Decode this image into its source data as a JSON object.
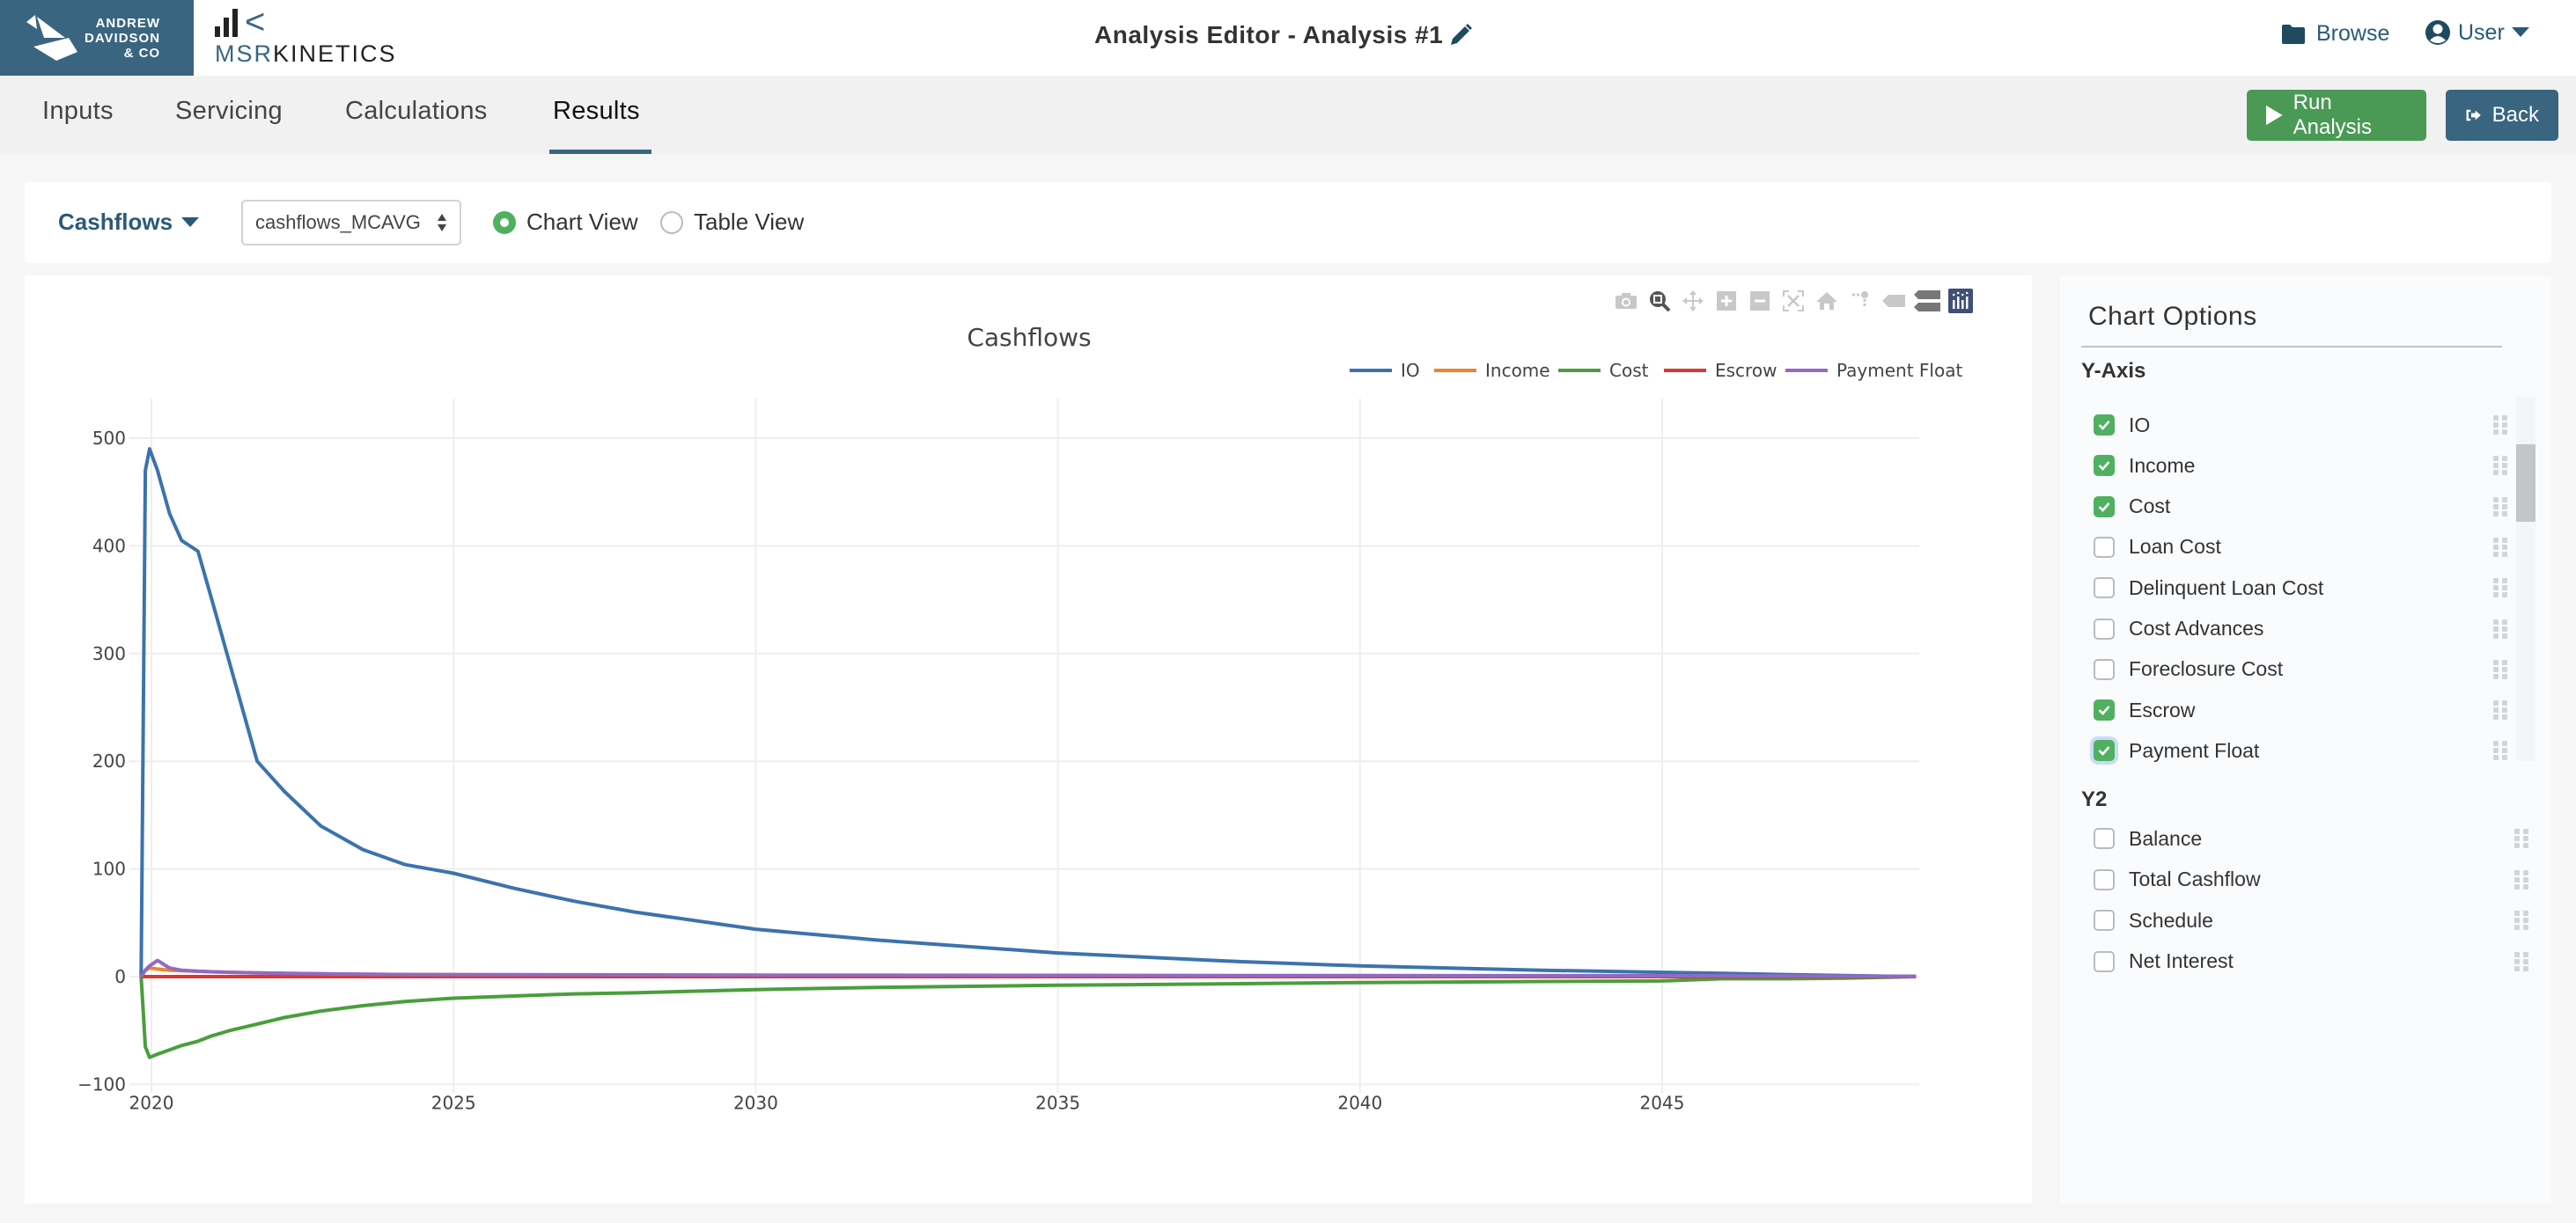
{
  "header": {
    "brand_left": [
      "ANDREW",
      "DAVIDSON",
      "& CO"
    ],
    "brand_right_a": "MSR",
    "brand_right_b": "KINETICS",
    "title": "Analysis Editor - Analysis #1",
    "edit_icon": "pencil-icon",
    "browse_label": "Browse",
    "browse_icon": "folder-icon",
    "user_label": "User",
    "user_icon": "user-circle-icon"
  },
  "tabs": [
    {
      "label": "Inputs",
      "active": false
    },
    {
      "label": "Servicing",
      "active": false
    },
    {
      "label": "Calculations",
      "active": false
    },
    {
      "label": "Results",
      "active": true
    }
  ],
  "actions": {
    "run_label": "Run Analysis",
    "run_icon": "play-icon",
    "back_label": "Back",
    "back_icon": "sign-out-icon"
  },
  "filters": {
    "report_label": "Cashflows",
    "dataset_value": "cashflows_MCAVG",
    "view_options": [
      {
        "label": "Chart View",
        "selected": true
      },
      {
        "label": "Table View",
        "selected": false
      }
    ]
  },
  "modebar": [
    "camera-icon",
    "zoom-icon",
    "pan-icon",
    "zoom-in-icon",
    "zoom-out-icon",
    "autoscale-icon",
    "reset-axes-icon",
    "spike-lines-icon",
    "hover-closest-icon",
    "hover-compare-icon",
    "plotly-logo-icon"
  ],
  "chart_data": {
    "type": "line",
    "title": "Cashflows",
    "xlabel": "",
    "ylabel": "",
    "xlim": [
      2019.8,
      2049.2
    ],
    "ylim": [
      -100,
      520
    ],
    "xticks": [
      2020,
      2025,
      2030,
      2035,
      2040,
      2045
    ],
    "yticks": [
      -100,
      0,
      100,
      200,
      300,
      400,
      500
    ],
    "ytick_labels": [
      "−100",
      "0",
      "100",
      "200",
      "300",
      "400",
      "500"
    ],
    "grid": true,
    "legend_position": "top-right",
    "x": [
      2019.83,
      2019.9,
      2019.97,
      2020.1,
      2020.3,
      2020.5,
      2020.77,
      2021.0,
      2021.3,
      2021.75,
      2022.2,
      2022.8,
      2023.5,
      2024.2,
      2025,
      2026,
      2027,
      2028,
      2030,
      2032,
      2035,
      2038,
      2040,
      2043,
      2045,
      2046,
      2047,
      2048,
      2049.2
    ],
    "series": [
      {
        "name": "IO",
        "color": "#3b73ad",
        "values": [
          0,
          470,
          490,
          470,
          430,
          405,
          395,
          350,
          290,
          200,
          172,
          140,
          118,
          104,
          96,
          82,
          70,
          60,
          44,
          34,
          22,
          14,
          10,
          6,
          4,
          3,
          2,
          1,
          0
        ]
      },
      {
        "name": "Income",
        "color": "#f0842d",
        "values": [
          0,
          6,
          8,
          7,
          6,
          5.5,
          5,
          4.5,
          4,
          3.5,
          3,
          2.6,
          2.2,
          2,
          1.8,
          1.6,
          1.5,
          1.4,
          1.2,
          1.1,
          1,
          0.8,
          0.7,
          0.5,
          0.4,
          0.3,
          0.2,
          0.1,
          0
        ]
      },
      {
        "name": "Cost",
        "color": "#4a9e3d",
        "values": [
          0,
          -65,
          -75,
          -72,
          -68,
          -64,
          -60,
          -55,
          -50,
          -44,
          -38,
          -32,
          -27,
          -23,
          -20,
          -18,
          -16,
          -15,
          -12,
          -10,
          -8,
          -6.5,
          -5.5,
          -4.5,
          -4,
          -2,
          -2,
          -1.5,
          0
        ]
      },
      {
        "name": "Escrow",
        "color": "#d33b33",
        "values": [
          0,
          0,
          0,
          0,
          0,
          0,
          0,
          0,
          0,
          0,
          0,
          0,
          0,
          0,
          0,
          0,
          0,
          0,
          0,
          0,
          0,
          0,
          0,
          0,
          0,
          0,
          0,
          0,
          0
        ]
      },
      {
        "name": "Payment Float",
        "color": "#9369c4",
        "values": [
          0,
          6,
          10,
          15,
          8,
          6,
          5,
          4.5,
          4,
          3.5,
          3,
          2.6,
          2.2,
          2,
          1.9,
          1.8,
          1.7,
          1.6,
          1.4,
          1.3,
          1.2,
          1.1,
          1,
          0.9,
          0.8,
          0.7,
          0.6,
          0.5,
          0.4
        ]
      }
    ]
  },
  "options": {
    "title": "Chart Options",
    "y_axis_label": "Y-Axis",
    "y_axis_items": [
      {
        "label": "IO",
        "checked": true
      },
      {
        "label": "Income",
        "checked": true
      },
      {
        "label": "Cost",
        "checked": true
      },
      {
        "label": "Loan Cost",
        "checked": false
      },
      {
        "label": "Delinquent Loan Cost",
        "checked": false
      },
      {
        "label": "Cost Advances",
        "checked": false
      },
      {
        "label": "Foreclosure Cost",
        "checked": false
      },
      {
        "label": "Escrow",
        "checked": true
      },
      {
        "label": "Payment Float",
        "checked": true
      }
    ],
    "y2_label": "Y2",
    "y2_items": [
      {
        "label": "Balance",
        "checked": false
      },
      {
        "label": "Total Cashflow",
        "checked": false
      },
      {
        "label": "Schedule",
        "checked": false
      },
      {
        "label": "Net Interest",
        "checked": false
      }
    ]
  }
}
